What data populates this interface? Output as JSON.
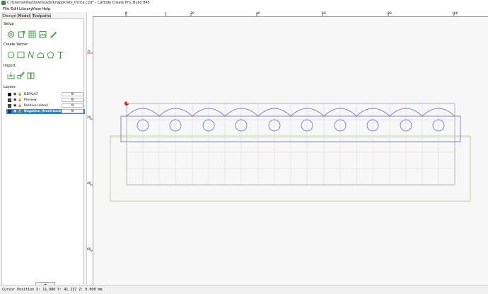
{
  "window": {
    "title": "C:/Users/wilia/Downloads/knappkrets_thrice.c2d* - Carbide Create Pro, Build 845"
  },
  "menu": [
    "File",
    "Edit",
    "Library",
    "View",
    "Help"
  ],
  "tabs": [
    "Design",
    "Model",
    "Toolpaths"
  ],
  "sections": {
    "setup": "Setup",
    "create_vector": "Create Vector",
    "import": "Import",
    "layers": "Layers"
  },
  "setup_tools": [
    "job-setup-icon",
    "stock-icon",
    "grid-icon",
    "image-icon",
    "pen-icon"
  ],
  "vector_tools": [
    "circle-icon",
    "rectangle-icon",
    "curve-icon",
    "polygon-icon",
    "pentagon-icon",
    "text-icon"
  ],
  "import_tools": [
    "import-icon",
    "trace-icon",
    "book-icon"
  ],
  "layers": [
    {
      "name": "DEFAULT",
      "color": "#000000",
      "selected": false
    },
    {
      "name": "Preview",
      "color": "#6b4a1d",
      "selected": false
    },
    {
      "name": "Positive (sides)",
      "color": "#1a7a1a",
      "selected": false
    },
    {
      "name": "Negative (front/back)",
      "color": "#1a2f9a",
      "selected": true
    }
  ],
  "add_layer_label": "+",
  "ruler": {
    "top": [
      "0",
      "20",
      "40",
      "60",
      "80",
      "100"
    ],
    "left": [
      "0",
      "20",
      "40",
      "60",
      "80"
    ]
  },
  "colors": {
    "selection_blue": "#2d84c7",
    "vector_blue": "#5555c8",
    "stock_olive": "#b9bb86",
    "origin_red": "#e02020"
  },
  "status": {
    "text": "Cursor Position X: 11.986 Y: 41.237 Z: 0.000 mm"
  }
}
